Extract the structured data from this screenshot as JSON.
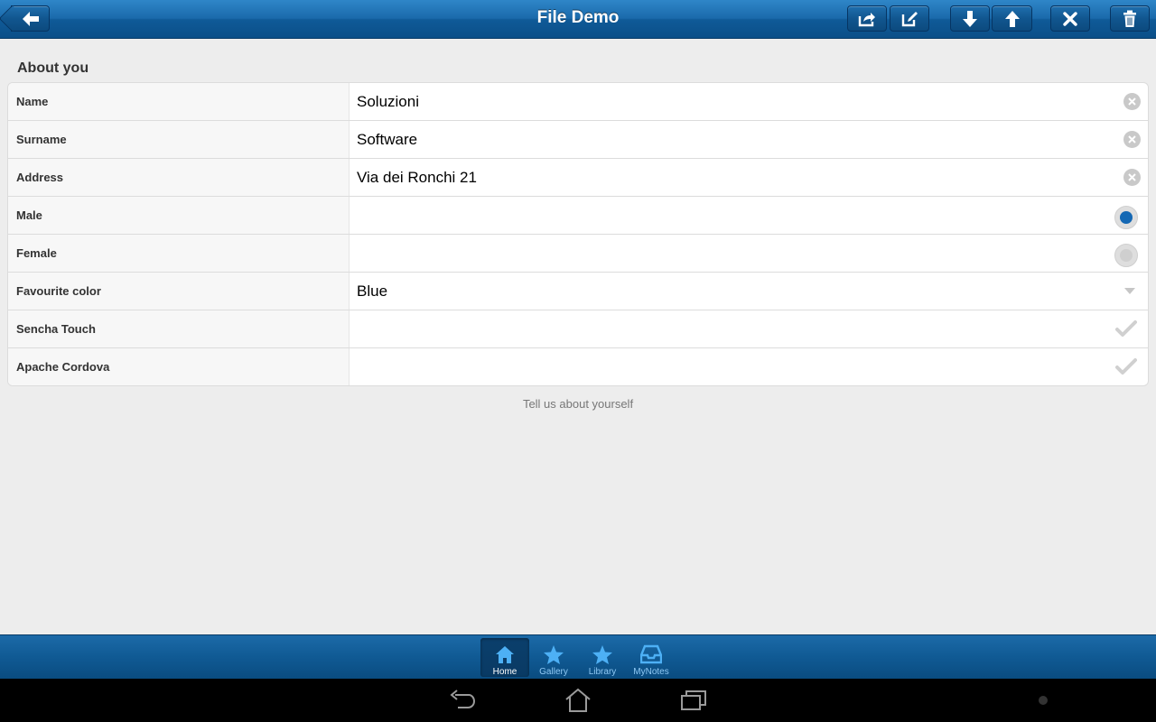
{
  "header": {
    "title": "File Demo"
  },
  "toolbar_icons": [
    "back-arrow-icon",
    "share-icon",
    "edit-icon",
    "arrow-down-icon",
    "arrow-up-icon",
    "close-icon",
    "trash-icon"
  ],
  "form": {
    "section_title": "About you",
    "fields": {
      "name": {
        "label": "Name",
        "value": "Soluzioni"
      },
      "surname": {
        "label": "Surname",
        "value": "Software"
      },
      "address": {
        "label": "Address",
        "value": "Via dei Ronchi 21"
      },
      "male": {
        "label": "Male",
        "checked": true
      },
      "female": {
        "label": "Female",
        "checked": false
      },
      "color": {
        "label": "Favourite color",
        "value": "Blue"
      },
      "sencha": {
        "label": "Sencha Touch",
        "checked": false
      },
      "cordova": {
        "label": "Apache Cordova",
        "checked": false
      }
    },
    "note": "Tell us about yourself"
  },
  "tabs": [
    {
      "label": "Home",
      "icon": "home-icon",
      "active": true
    },
    {
      "label": "Gallery",
      "icon": "star-icon",
      "active": false
    },
    {
      "label": "Library",
      "icon": "star-icon",
      "active": false
    },
    {
      "label": "MyNotes",
      "icon": "inbox-icon",
      "active": false
    }
  ],
  "colors": {
    "accent": "#1a6aab",
    "radio_selected": "#1468b4",
    "tab_inactive_label": "#8ec8f4"
  }
}
